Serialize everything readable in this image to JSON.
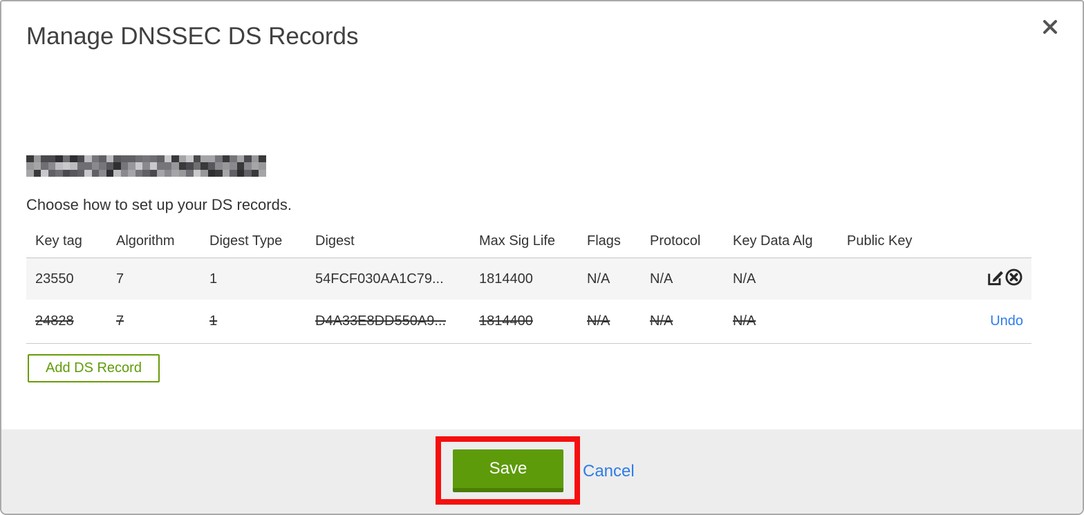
{
  "modal": {
    "title": "Manage DNSSEC DS Records",
    "subtitle": "Choose how to set up your DS records.",
    "domain_redacted": true
  },
  "table": {
    "headers": [
      "Key tag",
      "Algorithm",
      "Digest Type",
      "Digest",
      "Max Sig Life",
      "Flags",
      "Protocol",
      "Key Data Alg",
      "Public Key"
    ],
    "rows": [
      {
        "key_tag": "23550",
        "algorithm": "7",
        "digest_type": "1",
        "digest": "54FCF030AA1C79...",
        "max_sig_life": "1814400",
        "flags": "N/A",
        "protocol": "N/A",
        "key_data_alg": "N/A",
        "public_key": "",
        "struck": false,
        "actions": [
          "edit",
          "delete"
        ]
      },
      {
        "key_tag": "24828",
        "algorithm": "7",
        "digest_type": "1",
        "digest": "D4A33E8DD550A9...",
        "max_sig_life": "1814400",
        "flags": "N/A",
        "protocol": "N/A",
        "key_data_alg": "N/A",
        "public_key": "",
        "struck": true,
        "undo_label": "Undo"
      }
    ]
  },
  "buttons": {
    "add_record": "Add DS Record",
    "save": "Save",
    "cancel": "Cancel"
  },
  "colors": {
    "accent_green": "#5d9b0b",
    "outline_green": "#679b07",
    "link_blue": "#2e7ce9",
    "annotation_red": "#f50f0f",
    "row_highlight": "#f5f5f5",
    "footer_gray": "#ededed"
  }
}
